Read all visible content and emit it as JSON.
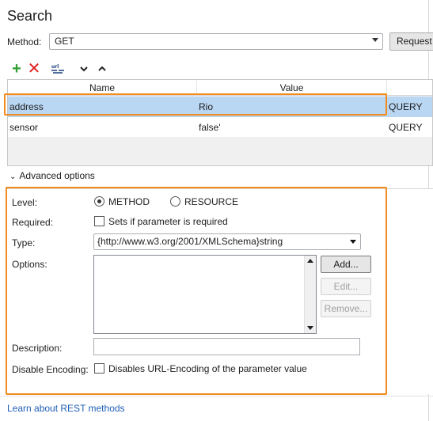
{
  "title": "Search",
  "method": {
    "label": "Method:",
    "value": "GET",
    "request_button": "Request"
  },
  "toolbar": {
    "add_icon": "plus-icon",
    "delete_icon": "delete-x-icon",
    "encode_icon": "url-encode-icon",
    "down_icon": "chevron-down-icon",
    "up_icon": "chevron-up-icon"
  },
  "table": {
    "columns": [
      "Name",
      "Value"
    ],
    "rows": [
      {
        "name": "address",
        "value": "Rio",
        "style": "QUERY"
      },
      {
        "name": "sensor",
        "value": "false'",
        "style": "QUERY"
      }
    ]
  },
  "advanced": {
    "toggle_label": "Advanced options",
    "level": {
      "label": "Level:",
      "option_method": "METHOD",
      "option_resource": "RESOURCE",
      "selected": "METHOD"
    },
    "required": {
      "label": "Required:",
      "checkbox_text": "Sets if parameter is required",
      "checked": false
    },
    "type": {
      "label": "Type:",
      "value": "{http://www.w3.org/2001/XMLSchema}string"
    },
    "options": {
      "label": "Options:",
      "add_button": "Add...",
      "edit_button": "Edit...",
      "remove_button": "Remove..."
    },
    "description": {
      "label": "Description:",
      "value": ""
    },
    "disable_encoding": {
      "label": "Disable Encoding:",
      "checkbox_text": "Disables URL-Encoding of the parameter value",
      "checked": false
    }
  },
  "footer": {
    "link": "Learn about REST methods"
  },
  "colors": {
    "highlight": "#f28c1e",
    "selected_row": "#b9d6f3",
    "link": "#1f5fb5",
    "add": "#2f9e2f",
    "delete": "#e02020"
  }
}
